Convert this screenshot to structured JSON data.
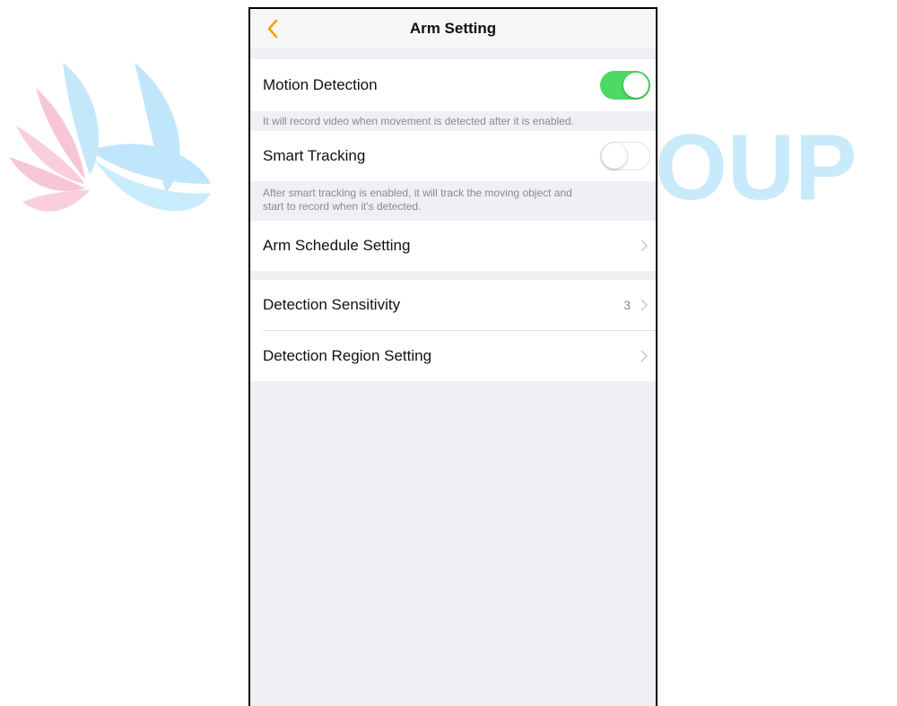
{
  "header": {
    "title": "Arm Setting",
    "back_icon": "chevron-left-icon",
    "accent_color": "#f0a30a"
  },
  "motion": {
    "label": "Motion Detection",
    "enabled": true,
    "note": "It will record video when movement is detected after it is enabled."
  },
  "tracking": {
    "label": "Smart Tracking",
    "enabled": false,
    "note_line1": "After smart tracking is enabled, it will track the moving object and",
    "note_line2": "start to record when it's detected."
  },
  "schedule": {
    "label": "Arm Schedule Setting"
  },
  "sensitivity": {
    "label": "Detection Sensitivity",
    "value": "3"
  },
  "region": {
    "label": "Detection Region Setting"
  },
  "watermark": {
    "text": "OUP",
    "color": "#c9eafb"
  },
  "colors": {
    "toggle_on": "#4cd964",
    "background": "#efeff4"
  }
}
